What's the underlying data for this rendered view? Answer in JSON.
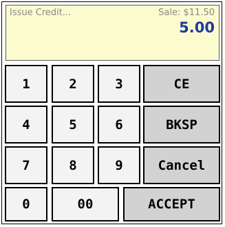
{
  "display": {
    "title": "Issue Credit...",
    "sale": "Sale: $11.50",
    "amount": "5.00"
  },
  "keys": {
    "one": "1",
    "two": "2",
    "three": "3",
    "four": "4",
    "five": "5",
    "six": "6",
    "seven": "7",
    "eight": "8",
    "nine": "9",
    "zero": "0",
    "double_zero": "00",
    "ce": "CE",
    "bksp": "BKSP",
    "cancel": "Cancel",
    "accept": "ACCEPT"
  },
  "colors": {
    "display_bg": "#fcfbd0",
    "amount_text": "#1f3a9a",
    "number_key_bg": "#f3f3f3",
    "function_key_bg": "#d2d2d2"
  }
}
